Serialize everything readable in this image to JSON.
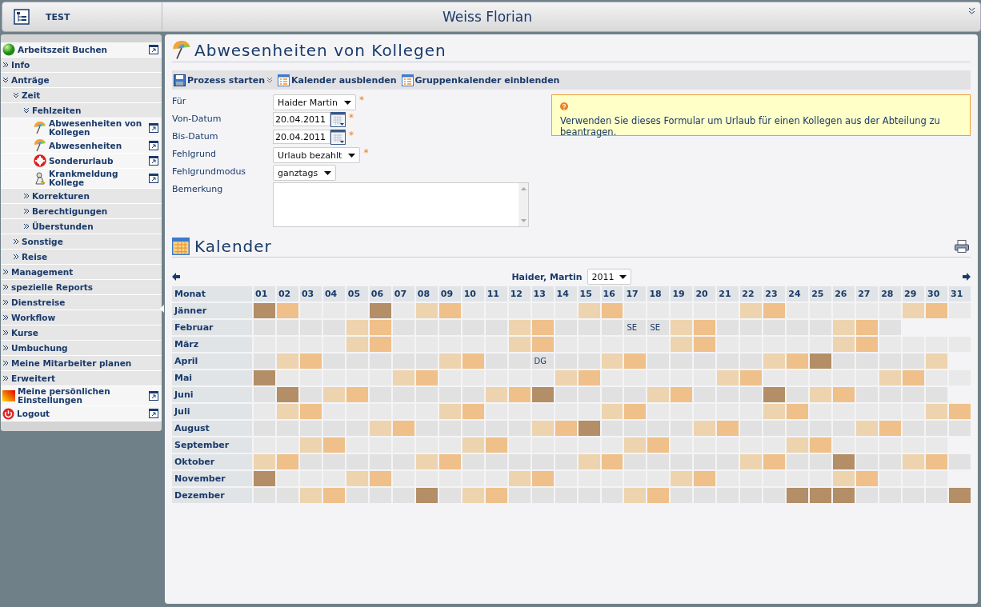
{
  "header": {
    "title": "TEST",
    "user": "Weiss Florian"
  },
  "sidebar": {
    "items": [
      {
        "label": "Arbeitszeit Buchen",
        "kind": "link"
      },
      {
        "label": "Info",
        "kind": "folder",
        "expanded": false
      },
      {
        "label": "Anträge",
        "kind": "folder",
        "expanded": true,
        "children": [
          {
            "label": "Zeit",
            "kind": "folder",
            "expanded": true,
            "children": [
              {
                "label": "Fehlzeiten",
                "kind": "folder",
                "expanded": true,
                "children": [
                  {
                    "label": "Abwesenheiten von Kollegen",
                    "kind": "link"
                  },
                  {
                    "label": "Abwesenheiten",
                    "kind": "link"
                  },
                  {
                    "label": "Sonderurlaub",
                    "kind": "link"
                  },
                  {
                    "label": "Krankmeldung Kollege",
                    "kind": "link"
                  }
                ]
              },
              {
                "label": "Korrekturen",
                "kind": "folder",
                "expanded": false
              },
              {
                "label": "Berechtigungen",
                "kind": "folder",
                "expanded": false
              },
              {
                "label": "Überstunden",
                "kind": "folder",
                "expanded": false
              }
            ]
          },
          {
            "label": "Sonstige",
            "kind": "folder",
            "expanded": false
          },
          {
            "label": "Reise",
            "kind": "folder",
            "expanded": false
          }
        ]
      },
      {
        "label": "Management",
        "kind": "folder",
        "expanded": false
      },
      {
        "label": "spezielle Reports",
        "kind": "folder",
        "expanded": false
      },
      {
        "label": "Dienstreise",
        "kind": "folder",
        "expanded": false
      },
      {
        "label": "Workflow",
        "kind": "folder",
        "expanded": false
      },
      {
        "label": "Kurse",
        "kind": "folder",
        "expanded": false
      },
      {
        "label": "Umbuchung",
        "kind": "folder",
        "expanded": false
      },
      {
        "label": "Meine Mitarbeiter planen",
        "kind": "folder",
        "expanded": false
      },
      {
        "label": "Erweitert",
        "kind": "folder",
        "expanded": false
      },
      {
        "label": "Meine persönlichen Einstellungen",
        "kind": "link"
      },
      {
        "label": "Logout",
        "kind": "link"
      }
    ]
  },
  "page": {
    "title": "Abwesenheiten von Kollegen"
  },
  "toolbar": [
    {
      "label": "Prozess starten",
      "has_menu": true
    },
    {
      "label": "Kalender ausblenden",
      "has_menu": false
    },
    {
      "label": "Gruppenkalender einblenden",
      "has_menu": false
    }
  ],
  "form": {
    "fields": [
      {
        "label": "Für",
        "kind": "select",
        "value": "Haider Martin",
        "required_mark": "*"
      },
      {
        "label": "Von-Datum",
        "kind": "date",
        "value": "20.04.2011",
        "required_mark": "*"
      },
      {
        "label": "Bis-Datum",
        "kind": "date",
        "value": "20.04.2011",
        "required_mark": "*"
      },
      {
        "label": "Fehlgrund",
        "kind": "select",
        "value": "Urlaub bezahlt",
        "required_mark": "*"
      },
      {
        "label": "Fehlgrundmodus",
        "kind": "select",
        "value": "ganztags"
      },
      {
        "label": "Bemerkung",
        "kind": "textarea"
      }
    ],
    "hint": "Verwenden Sie dieses Formular um Urlaub für einen Kollegen aus der Abteilung zu beantragen."
  },
  "calendar": {
    "title": "Kalender",
    "person": "Haider, Martin",
    "year": "2011",
    "month_heading": "Monat",
    "days": [
      "01",
      "02",
      "03",
      "04",
      "05",
      "06",
      "07",
      "08",
      "09",
      "10",
      "11",
      "12",
      "13",
      "14",
      "15",
      "16",
      "17",
      "18",
      "19",
      "20",
      "21",
      "22",
      "23",
      "24",
      "25",
      "26",
      "27",
      "28",
      "29",
      "30",
      "31"
    ],
    "months": [
      {
        "name": "Jänner",
        "cells": [
          {
            "kind": "hol"
          },
          {
            "kind": "sun"
          },
          {
            "kind": "work"
          },
          {
            "kind": "work"
          },
          {
            "kind": "work"
          },
          {
            "kind": "hol"
          },
          {
            "kind": "work"
          },
          {
            "kind": "sat"
          },
          {
            "kind": "sun"
          },
          {
            "kind": "work"
          },
          {
            "kind": "work"
          },
          {
            "kind": "work"
          },
          {
            "kind": "work"
          },
          {
            "kind": "work"
          },
          {
            "kind": "sat"
          },
          {
            "kind": "sun"
          },
          {
            "kind": "work"
          },
          {
            "kind": "work"
          },
          {
            "kind": "work"
          },
          {
            "kind": "work"
          },
          {
            "kind": "work"
          },
          {
            "kind": "sat"
          },
          {
            "kind": "sun"
          },
          {
            "kind": "work"
          },
          {
            "kind": "work"
          },
          {
            "kind": "work"
          },
          {
            "kind": "work"
          },
          {
            "kind": "work"
          },
          {
            "kind": "sat"
          },
          {
            "kind": "sun"
          },
          {
            "kind": "work"
          }
        ]
      },
      {
        "name": "Februar",
        "cells": [
          {
            "kind": "work"
          },
          {
            "kind": "work"
          },
          {
            "kind": "work"
          },
          {
            "kind": "work"
          },
          {
            "kind": "sat"
          },
          {
            "kind": "sun"
          },
          {
            "kind": "work"
          },
          {
            "kind": "work"
          },
          {
            "kind": "work"
          },
          {
            "kind": "work"
          },
          {
            "kind": "work"
          },
          {
            "kind": "sat"
          },
          {
            "kind": "sun"
          },
          {
            "kind": "work"
          },
          {
            "kind": "work"
          },
          {
            "kind": "work"
          },
          {
            "kind": "work",
            "text": "SE"
          },
          {
            "kind": "work",
            "text": "SE"
          },
          {
            "kind": "sat"
          },
          {
            "kind": "sun"
          },
          {
            "kind": "work"
          },
          {
            "kind": "work"
          },
          {
            "kind": "work"
          },
          {
            "kind": "work"
          },
          {
            "kind": "work"
          },
          {
            "kind": "sat"
          },
          {
            "kind": "sun"
          },
          {
            "kind": "work"
          },
          {
            "kind": "none"
          },
          {
            "kind": "none"
          },
          {
            "kind": "none"
          }
        ]
      },
      {
        "name": "März",
        "cells": [
          {
            "kind": "work"
          },
          {
            "kind": "work"
          },
          {
            "kind": "work"
          },
          {
            "kind": "work"
          },
          {
            "kind": "sat"
          },
          {
            "kind": "sun"
          },
          {
            "kind": "work"
          },
          {
            "kind": "work"
          },
          {
            "kind": "work"
          },
          {
            "kind": "work"
          },
          {
            "kind": "work"
          },
          {
            "kind": "sat"
          },
          {
            "kind": "sun"
          },
          {
            "kind": "work"
          },
          {
            "kind": "work"
          },
          {
            "kind": "work"
          },
          {
            "kind": "work"
          },
          {
            "kind": "work"
          },
          {
            "kind": "sat"
          },
          {
            "kind": "sun"
          },
          {
            "kind": "work"
          },
          {
            "kind": "work"
          },
          {
            "kind": "work"
          },
          {
            "kind": "work"
          },
          {
            "kind": "work"
          },
          {
            "kind": "sat"
          },
          {
            "kind": "sun"
          },
          {
            "kind": "work"
          },
          {
            "kind": "work"
          },
          {
            "kind": "work"
          },
          {
            "kind": "work"
          }
        ]
      },
      {
        "name": "April",
        "cells": [
          {
            "kind": "work"
          },
          {
            "kind": "sat"
          },
          {
            "kind": "sun"
          },
          {
            "kind": "work"
          },
          {
            "kind": "work"
          },
          {
            "kind": "work"
          },
          {
            "kind": "work"
          },
          {
            "kind": "work"
          },
          {
            "kind": "sat"
          },
          {
            "kind": "sun"
          },
          {
            "kind": "work"
          },
          {
            "kind": "work"
          },
          {
            "kind": "work",
            "text": "DG"
          },
          {
            "kind": "work"
          },
          {
            "kind": "work"
          },
          {
            "kind": "sat"
          },
          {
            "kind": "sun"
          },
          {
            "kind": "work"
          },
          {
            "kind": "work"
          },
          {
            "kind": "work"
          },
          {
            "kind": "work"
          },
          {
            "kind": "work"
          },
          {
            "kind": "sat"
          },
          {
            "kind": "sun"
          },
          {
            "kind": "hol"
          },
          {
            "kind": "work"
          },
          {
            "kind": "work"
          },
          {
            "kind": "work"
          },
          {
            "kind": "work"
          },
          {
            "kind": "sat"
          },
          {
            "kind": "none"
          }
        ]
      },
      {
        "name": "Mai",
        "cells": [
          {
            "kind": "hol"
          },
          {
            "kind": "work"
          },
          {
            "kind": "work"
          },
          {
            "kind": "work"
          },
          {
            "kind": "work"
          },
          {
            "kind": "work"
          },
          {
            "kind": "sat"
          },
          {
            "kind": "sun"
          },
          {
            "kind": "work"
          },
          {
            "kind": "work"
          },
          {
            "kind": "work"
          },
          {
            "kind": "work"
          },
          {
            "kind": "work"
          },
          {
            "kind": "sat"
          },
          {
            "kind": "sun"
          },
          {
            "kind": "work"
          },
          {
            "kind": "work"
          },
          {
            "kind": "work"
          },
          {
            "kind": "work"
          },
          {
            "kind": "work"
          },
          {
            "kind": "sat"
          },
          {
            "kind": "sun"
          },
          {
            "kind": "work"
          },
          {
            "kind": "work"
          },
          {
            "kind": "work"
          },
          {
            "kind": "work"
          },
          {
            "kind": "work"
          },
          {
            "kind": "sat"
          },
          {
            "kind": "sun"
          },
          {
            "kind": "work"
          },
          {
            "kind": "work"
          }
        ]
      },
      {
        "name": "Juni",
        "cells": [
          {
            "kind": "work"
          },
          {
            "kind": "hol"
          },
          {
            "kind": "work"
          },
          {
            "kind": "sat"
          },
          {
            "kind": "sun"
          },
          {
            "kind": "work"
          },
          {
            "kind": "work"
          },
          {
            "kind": "work"
          },
          {
            "kind": "work"
          },
          {
            "kind": "work"
          },
          {
            "kind": "sat"
          },
          {
            "kind": "sun"
          },
          {
            "kind": "hol"
          },
          {
            "kind": "work"
          },
          {
            "kind": "work"
          },
          {
            "kind": "work"
          },
          {
            "kind": "work"
          },
          {
            "kind": "sat"
          },
          {
            "kind": "sun"
          },
          {
            "kind": "work"
          },
          {
            "kind": "work"
          },
          {
            "kind": "work"
          },
          {
            "kind": "hol"
          },
          {
            "kind": "work"
          },
          {
            "kind": "sat"
          },
          {
            "kind": "sun"
          },
          {
            "kind": "work"
          },
          {
            "kind": "work"
          },
          {
            "kind": "work"
          },
          {
            "kind": "work"
          },
          {
            "kind": "none"
          }
        ]
      },
      {
        "name": "Juli",
        "cells": [
          {
            "kind": "work"
          },
          {
            "kind": "sat"
          },
          {
            "kind": "sun"
          },
          {
            "kind": "work"
          },
          {
            "kind": "work"
          },
          {
            "kind": "work"
          },
          {
            "kind": "work"
          },
          {
            "kind": "work"
          },
          {
            "kind": "sat"
          },
          {
            "kind": "sun"
          },
          {
            "kind": "work"
          },
          {
            "kind": "work"
          },
          {
            "kind": "work"
          },
          {
            "kind": "work"
          },
          {
            "kind": "work"
          },
          {
            "kind": "sat"
          },
          {
            "kind": "sun"
          },
          {
            "kind": "work"
          },
          {
            "kind": "work"
          },
          {
            "kind": "work"
          },
          {
            "kind": "work"
          },
          {
            "kind": "work"
          },
          {
            "kind": "sat"
          },
          {
            "kind": "sun"
          },
          {
            "kind": "work"
          },
          {
            "kind": "work"
          },
          {
            "kind": "work"
          },
          {
            "kind": "work"
          },
          {
            "kind": "work"
          },
          {
            "kind": "sat"
          },
          {
            "kind": "sun"
          }
        ]
      },
      {
        "name": "August",
        "cells": [
          {
            "kind": "work"
          },
          {
            "kind": "work"
          },
          {
            "kind": "work"
          },
          {
            "kind": "work"
          },
          {
            "kind": "work"
          },
          {
            "kind": "sat"
          },
          {
            "kind": "sun"
          },
          {
            "kind": "work"
          },
          {
            "kind": "work"
          },
          {
            "kind": "work"
          },
          {
            "kind": "work"
          },
          {
            "kind": "work"
          },
          {
            "kind": "sat"
          },
          {
            "kind": "sun"
          },
          {
            "kind": "hol"
          },
          {
            "kind": "work"
          },
          {
            "kind": "work"
          },
          {
            "kind": "work"
          },
          {
            "kind": "work"
          },
          {
            "kind": "sat"
          },
          {
            "kind": "sun"
          },
          {
            "kind": "work"
          },
          {
            "kind": "work"
          },
          {
            "kind": "work"
          },
          {
            "kind": "work"
          },
          {
            "kind": "work"
          },
          {
            "kind": "sat"
          },
          {
            "kind": "sun"
          },
          {
            "kind": "work"
          },
          {
            "kind": "work"
          },
          {
            "kind": "work"
          }
        ]
      },
      {
        "name": "September",
        "cells": [
          {
            "kind": "work"
          },
          {
            "kind": "work"
          },
          {
            "kind": "sat"
          },
          {
            "kind": "sun"
          },
          {
            "kind": "work"
          },
          {
            "kind": "work"
          },
          {
            "kind": "work"
          },
          {
            "kind": "work"
          },
          {
            "kind": "work"
          },
          {
            "kind": "sat"
          },
          {
            "kind": "sun"
          },
          {
            "kind": "work"
          },
          {
            "kind": "work"
          },
          {
            "kind": "work"
          },
          {
            "kind": "work"
          },
          {
            "kind": "work"
          },
          {
            "kind": "sat"
          },
          {
            "kind": "sun"
          },
          {
            "kind": "work"
          },
          {
            "kind": "work"
          },
          {
            "kind": "work"
          },
          {
            "kind": "work"
          },
          {
            "kind": "work"
          },
          {
            "kind": "sat"
          },
          {
            "kind": "sun"
          },
          {
            "kind": "work"
          },
          {
            "kind": "work"
          },
          {
            "kind": "work"
          },
          {
            "kind": "work"
          },
          {
            "kind": "work"
          },
          {
            "kind": "none"
          }
        ]
      },
      {
        "name": "Oktober",
        "cells": [
          {
            "kind": "sat"
          },
          {
            "kind": "sun"
          },
          {
            "kind": "work"
          },
          {
            "kind": "work"
          },
          {
            "kind": "work"
          },
          {
            "kind": "work"
          },
          {
            "kind": "work"
          },
          {
            "kind": "sat"
          },
          {
            "kind": "sun"
          },
          {
            "kind": "work"
          },
          {
            "kind": "work"
          },
          {
            "kind": "work"
          },
          {
            "kind": "work"
          },
          {
            "kind": "work"
          },
          {
            "kind": "sat"
          },
          {
            "kind": "sun"
          },
          {
            "kind": "work"
          },
          {
            "kind": "work"
          },
          {
            "kind": "work"
          },
          {
            "kind": "work"
          },
          {
            "kind": "work"
          },
          {
            "kind": "sat"
          },
          {
            "kind": "sun"
          },
          {
            "kind": "work"
          },
          {
            "kind": "work"
          },
          {
            "kind": "hol"
          },
          {
            "kind": "work"
          },
          {
            "kind": "work"
          },
          {
            "kind": "sat"
          },
          {
            "kind": "sun"
          },
          {
            "kind": "work"
          }
        ]
      },
      {
        "name": "November",
        "cells": [
          {
            "kind": "hol"
          },
          {
            "kind": "work"
          },
          {
            "kind": "work"
          },
          {
            "kind": "work"
          },
          {
            "kind": "sat"
          },
          {
            "kind": "sun"
          },
          {
            "kind": "work"
          },
          {
            "kind": "work"
          },
          {
            "kind": "work"
          },
          {
            "kind": "work"
          },
          {
            "kind": "work"
          },
          {
            "kind": "sat"
          },
          {
            "kind": "sun"
          },
          {
            "kind": "work"
          },
          {
            "kind": "work"
          },
          {
            "kind": "work"
          },
          {
            "kind": "work"
          },
          {
            "kind": "work"
          },
          {
            "kind": "sat"
          },
          {
            "kind": "sun"
          },
          {
            "kind": "work"
          },
          {
            "kind": "work"
          },
          {
            "kind": "work"
          },
          {
            "kind": "work"
          },
          {
            "kind": "work"
          },
          {
            "kind": "sat"
          },
          {
            "kind": "sun"
          },
          {
            "kind": "work"
          },
          {
            "kind": "work"
          },
          {
            "kind": "work"
          },
          {
            "kind": "none"
          }
        ]
      },
      {
        "name": "Dezember",
        "cells": [
          {
            "kind": "work"
          },
          {
            "kind": "work"
          },
          {
            "kind": "sat"
          },
          {
            "kind": "sun"
          },
          {
            "kind": "work"
          },
          {
            "kind": "work"
          },
          {
            "kind": "work"
          },
          {
            "kind": "hol"
          },
          {
            "kind": "work"
          },
          {
            "kind": "sat"
          },
          {
            "kind": "sun"
          },
          {
            "kind": "work"
          },
          {
            "kind": "work"
          },
          {
            "kind": "work"
          },
          {
            "kind": "work"
          },
          {
            "kind": "work"
          },
          {
            "kind": "sat"
          },
          {
            "kind": "sun"
          },
          {
            "kind": "work"
          },
          {
            "kind": "work"
          },
          {
            "kind": "work"
          },
          {
            "kind": "work"
          },
          {
            "kind": "work"
          },
          {
            "kind": "hol"
          },
          {
            "kind": "hol"
          },
          {
            "kind": "hol"
          },
          {
            "kind": "work"
          },
          {
            "kind": "work"
          },
          {
            "kind": "work"
          },
          {
            "kind": "work"
          },
          {
            "kind": "hol"
          }
        ]
      }
    ]
  }
}
